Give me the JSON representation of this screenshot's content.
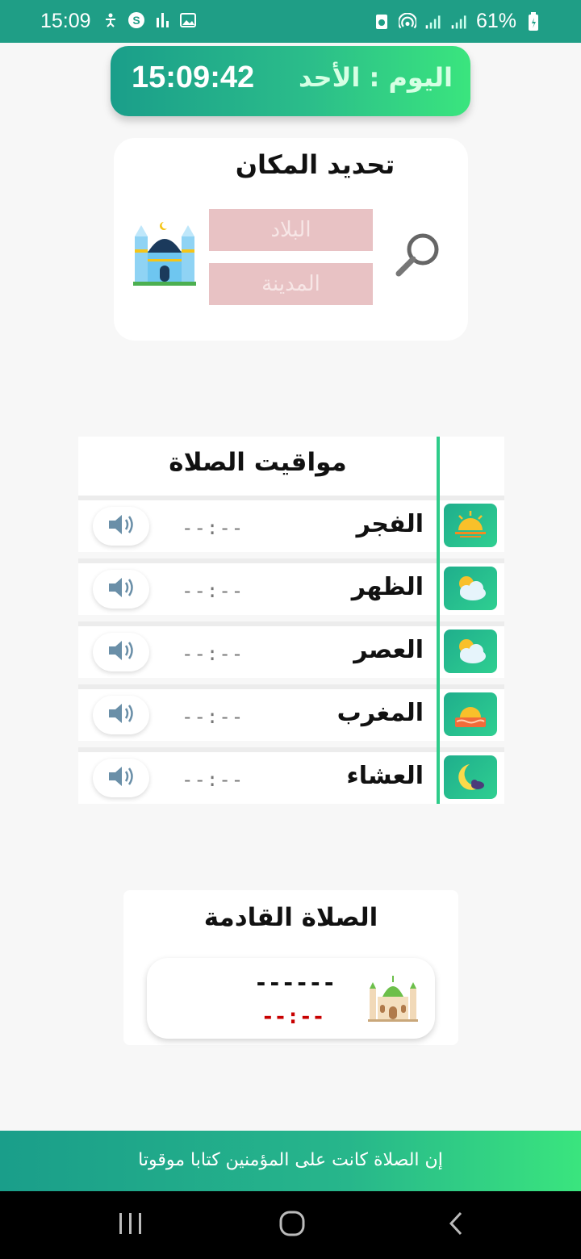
{
  "status_bar": {
    "time": "15:09",
    "battery": "61%"
  },
  "clock": {
    "time": "15:09:42",
    "day_label": "اليوم : الأحد"
  },
  "location": {
    "title": "تحديد المكان",
    "country_placeholder": "البلاد",
    "city_placeholder": "المدينة"
  },
  "prayers": {
    "title": "مواقيت الصلاة",
    "rows": [
      {
        "name": "الفجر",
        "time": "--:--",
        "icon": "sunrise-icon"
      },
      {
        "name": "الظهر",
        "time": "--:--",
        "icon": "sun-cloud-icon"
      },
      {
        "name": "العصر",
        "time": "--:--",
        "icon": "sun-cloud-icon"
      },
      {
        "name": "المغرب",
        "time": "--:--",
        "icon": "sunset-icon"
      },
      {
        "name": "العشاء",
        "time": "--:--",
        "icon": "moon-icon"
      }
    ]
  },
  "next_prayer": {
    "title": "الصلاة القادمة",
    "name": "------",
    "time": "--:--"
  },
  "footer": {
    "verse": "إن الصلاة كانت على المؤمنين كتابا موقوتا"
  },
  "colors": {
    "accent": "#1f9e86",
    "accent_light": "#3ae57e",
    "input_bg": "#e8c2c4",
    "next_time": "#c80000"
  }
}
